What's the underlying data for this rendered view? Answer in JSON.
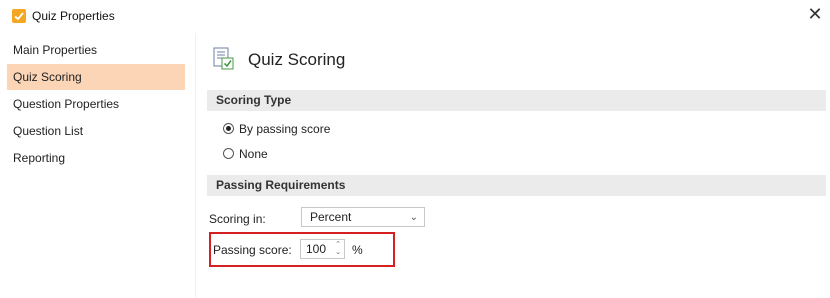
{
  "window": {
    "title": "Quiz Properties",
    "close_glyph": "✕"
  },
  "sidebar": {
    "items": [
      {
        "label": "Main Properties",
        "active": false
      },
      {
        "label": "Quiz Scoring",
        "active": true
      },
      {
        "label": "Question Properties",
        "active": false
      },
      {
        "label": "Question List",
        "active": false
      },
      {
        "label": "Reporting",
        "active": false
      }
    ]
  },
  "main": {
    "title": "Quiz Scoring",
    "scoring_type": {
      "header": "Scoring Type",
      "options": [
        {
          "label": "By passing score",
          "checked": true
        },
        {
          "label": "None",
          "checked": false
        }
      ]
    },
    "passing_requirements": {
      "header": "Passing Requirements",
      "scoring_in_label": "Scoring in:",
      "scoring_in_value": "Percent",
      "passing_score_label": "Passing score:",
      "passing_score_value": "100",
      "unit": "%"
    }
  },
  "colors": {
    "accent": "#f5a623",
    "active_item": "#fbd5b5",
    "section_bg": "#ebebeb",
    "highlight": "#d42020"
  },
  "icons": [
    "checkbox-app-icon",
    "close-icon",
    "quiz-scoring-page-icon",
    "chevron-down-icon",
    "spin-up-icon",
    "spin-down-icon"
  ]
}
